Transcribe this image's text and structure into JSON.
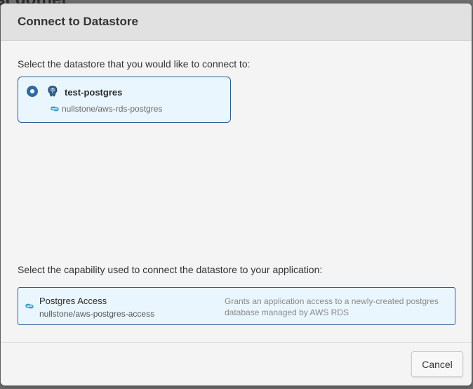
{
  "background": {
    "title_fragment": "st dotnet"
  },
  "modal": {
    "title": "Connect to Datastore",
    "datastore_prompt": "Select the datastore that you would like to connect to:",
    "datastores": [
      {
        "name": "test-postgres",
        "module": "nullstone/aws-rds-postgres",
        "icon": "postgres-elephant-icon",
        "selected": true
      }
    ],
    "capability_prompt": "Select the capability used to connect the datastore to your application:",
    "capabilities": [
      {
        "name": "Postgres Access",
        "module": "nullstone/aws-postgres-access",
        "description": "Grants an application access to a newly-created postgres database managed by AWS RDS",
        "icon": "module-link-icon"
      }
    ],
    "cancel_label": "Cancel"
  },
  "colors": {
    "accent": "#2e6aa8",
    "card_background": "#eaf6fd",
    "card_border": "#2e5d8f",
    "link_icon": "#2a9fc9"
  }
}
